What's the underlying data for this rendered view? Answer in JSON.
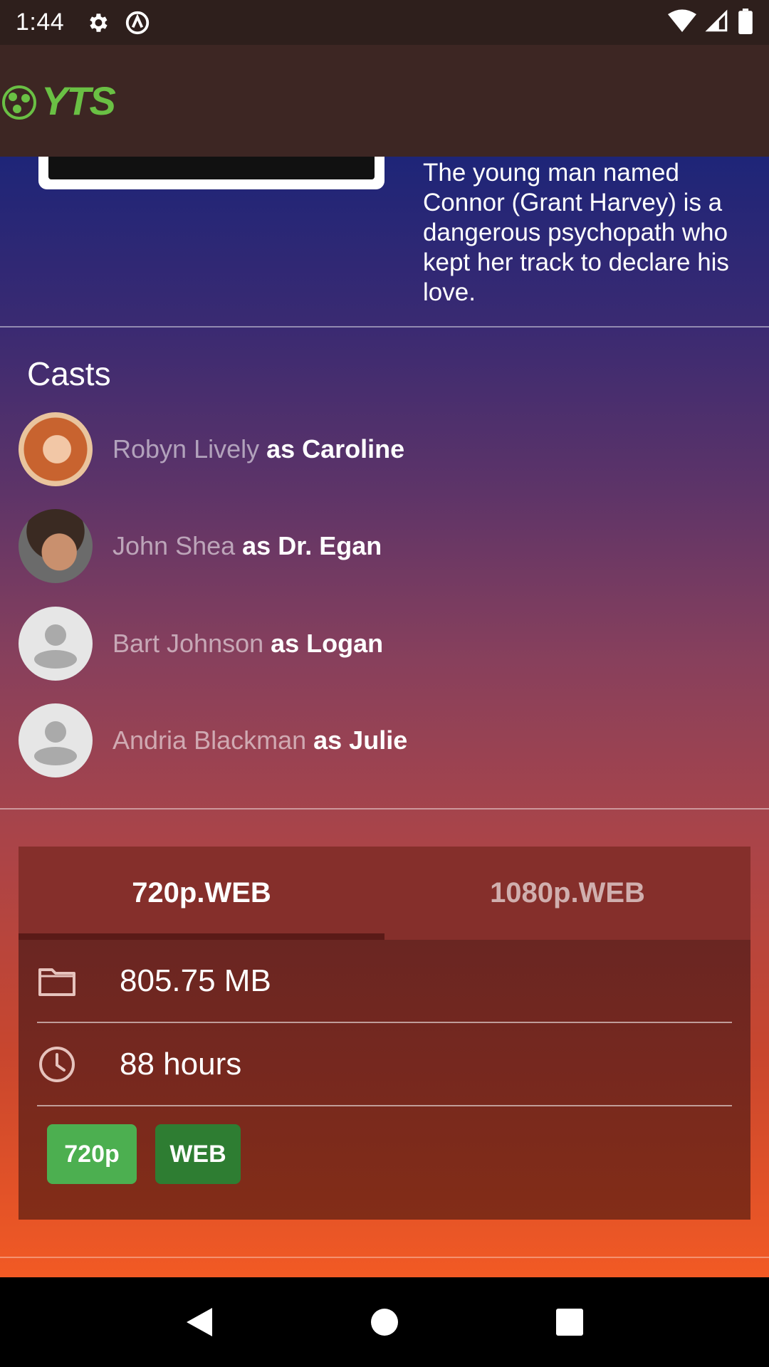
{
  "status_bar": {
    "time": "1:44",
    "icons": [
      "gear-icon",
      "circle-a-icon",
      "wifi-icon",
      "signal-icon",
      "battery-icon"
    ]
  },
  "app_bar": {
    "logo_text": "YTS",
    "logo_color": "#6ac044"
  },
  "synopsis": {
    "text": "The young man named Connor (Grant Harvey) is a dangerous psychopath who kept her track to declare his love."
  },
  "casts": {
    "title": "Casts",
    "items": [
      {
        "actor": "Robyn Lively",
        "role": "as Caroline",
        "avatar": "photo"
      },
      {
        "actor": "John Shea",
        "role": "as Dr. Egan",
        "avatar": "photo"
      },
      {
        "actor": "Bart Johnson",
        "role": "as Logan",
        "avatar": "placeholder-person-icon"
      },
      {
        "actor": "Andria Blackman",
        "role": "as Julie",
        "avatar": "placeholder-person-icon"
      }
    ]
  },
  "torrent": {
    "tabs": [
      {
        "label": "720p.WEB",
        "active": true
      },
      {
        "label": "1080p.WEB",
        "active": false
      }
    ],
    "size": "805.75 MB",
    "duration": "88 hours",
    "badges": [
      {
        "label": "720p",
        "color": "#4caf50"
      },
      {
        "label": "WEB",
        "color": "#2e7d32"
      }
    ]
  },
  "nav_bar": {
    "buttons": [
      "back-icon",
      "home-icon",
      "recents-icon"
    ]
  }
}
